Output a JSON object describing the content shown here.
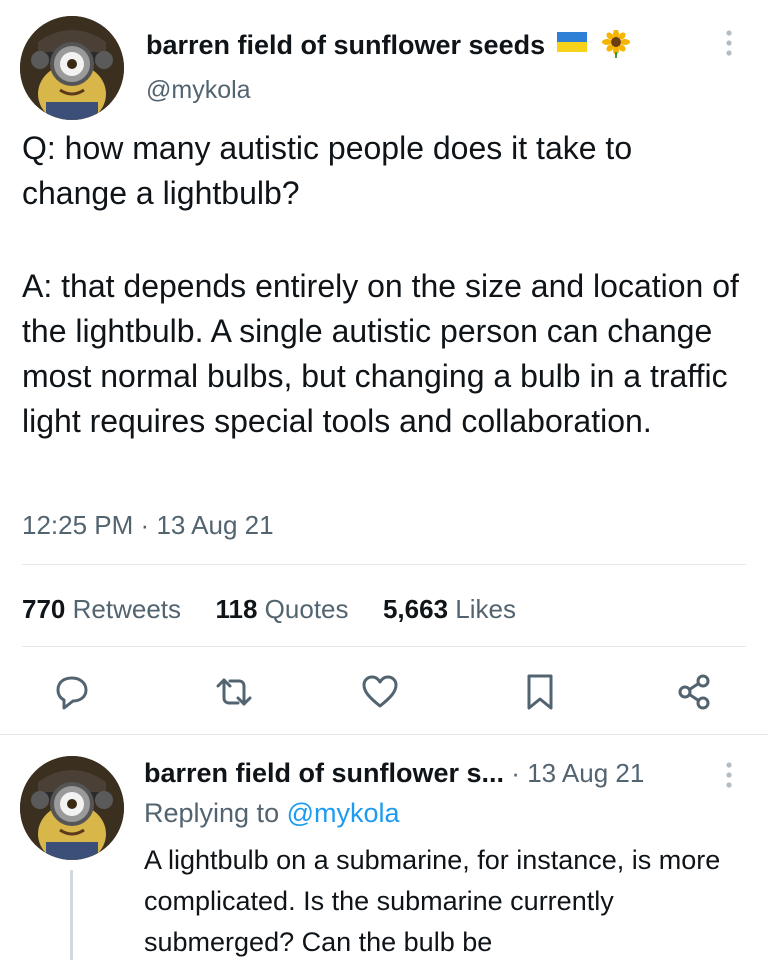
{
  "tweet": {
    "author_name": "barren field of sunflower seeds",
    "author_handle": "@mykola",
    "flag_emoji": "🇺🇦",
    "sunflower_emoji": "🌻",
    "question": "Q: how many autistic people does it take to change a lightbulb?",
    "answer": "A: that depends entirely on the size and location of the lightbulb. A single autistic person can change most normal bulbs, but changing a bulb in a traffic light requires special tools and collaboration.",
    "time": "12:25 PM",
    "date": "13 Aug 21",
    "separator": "·"
  },
  "stats": {
    "retweets_count": "770",
    "retweets_label": "Retweets",
    "quotes_count": "118",
    "quotes_label": "Quotes",
    "likes_count": "5,663",
    "likes_label": "Likes"
  },
  "actions": {
    "icons": [
      "reply-icon",
      "retweet-icon",
      "like-icon",
      "bookmark-icon",
      "share-icon"
    ]
  },
  "reply": {
    "author_name": "barren field of sunflower s...",
    "separator": "·",
    "date": "13 Aug 21",
    "replying_prefix": "Replying to",
    "replying_handle": "@mykola",
    "text": "A lightbulb on a submarine, for instance, is more complicated. Is the submarine currently submerged? Can the bulb be"
  },
  "colors": {
    "accent": "#1d9bf0",
    "text_primary": "#0f1419",
    "text_secondary": "#536471",
    "divider": "#e6e9eb"
  }
}
